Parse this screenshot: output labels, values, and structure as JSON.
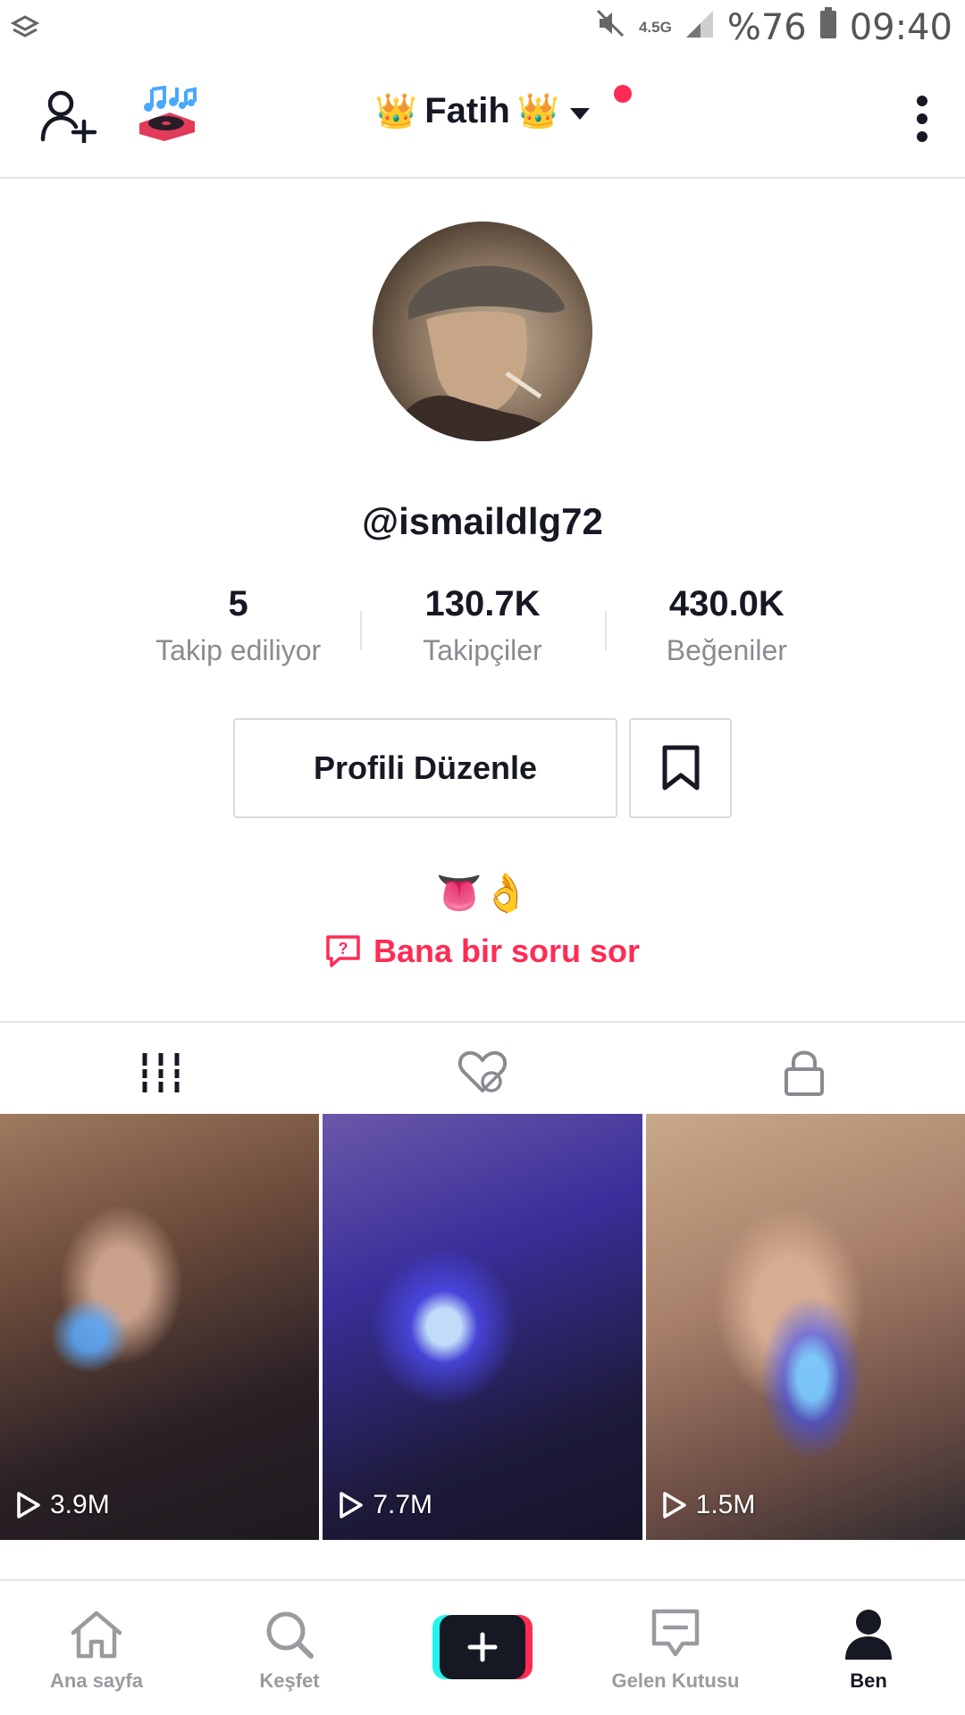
{
  "status_bar": {
    "network": "4.5G",
    "battery": "%76",
    "time": "09:40"
  },
  "header": {
    "title": "Fatih",
    "crown_emoji": "👑",
    "music_emoji": "🎶"
  },
  "profile": {
    "username": "@ismaildlg72",
    "stats": [
      {
        "value": "5",
        "label": "Takip ediliyor"
      },
      {
        "value": "130.7K",
        "label": "Takipçiler"
      },
      {
        "value": "430.0K",
        "label": "Beğeniler"
      }
    ],
    "edit_button": "Profili Düzenle",
    "bio": "👅👌",
    "ask_link": "Bana bir soru sor"
  },
  "videos": [
    {
      "views": "3.9M"
    },
    {
      "views": "7.7M"
    },
    {
      "views": "1.5M"
    }
  ],
  "bottom_nav": {
    "home": "Ana sayfa",
    "discover": "Keşfet",
    "inbox": "Gelen Kutusu",
    "me": "Ben"
  },
  "colors": {
    "accent": "#fe2c55",
    "text": "#161823",
    "muted": "#8a8b91",
    "cyan": "#25f4ee"
  }
}
